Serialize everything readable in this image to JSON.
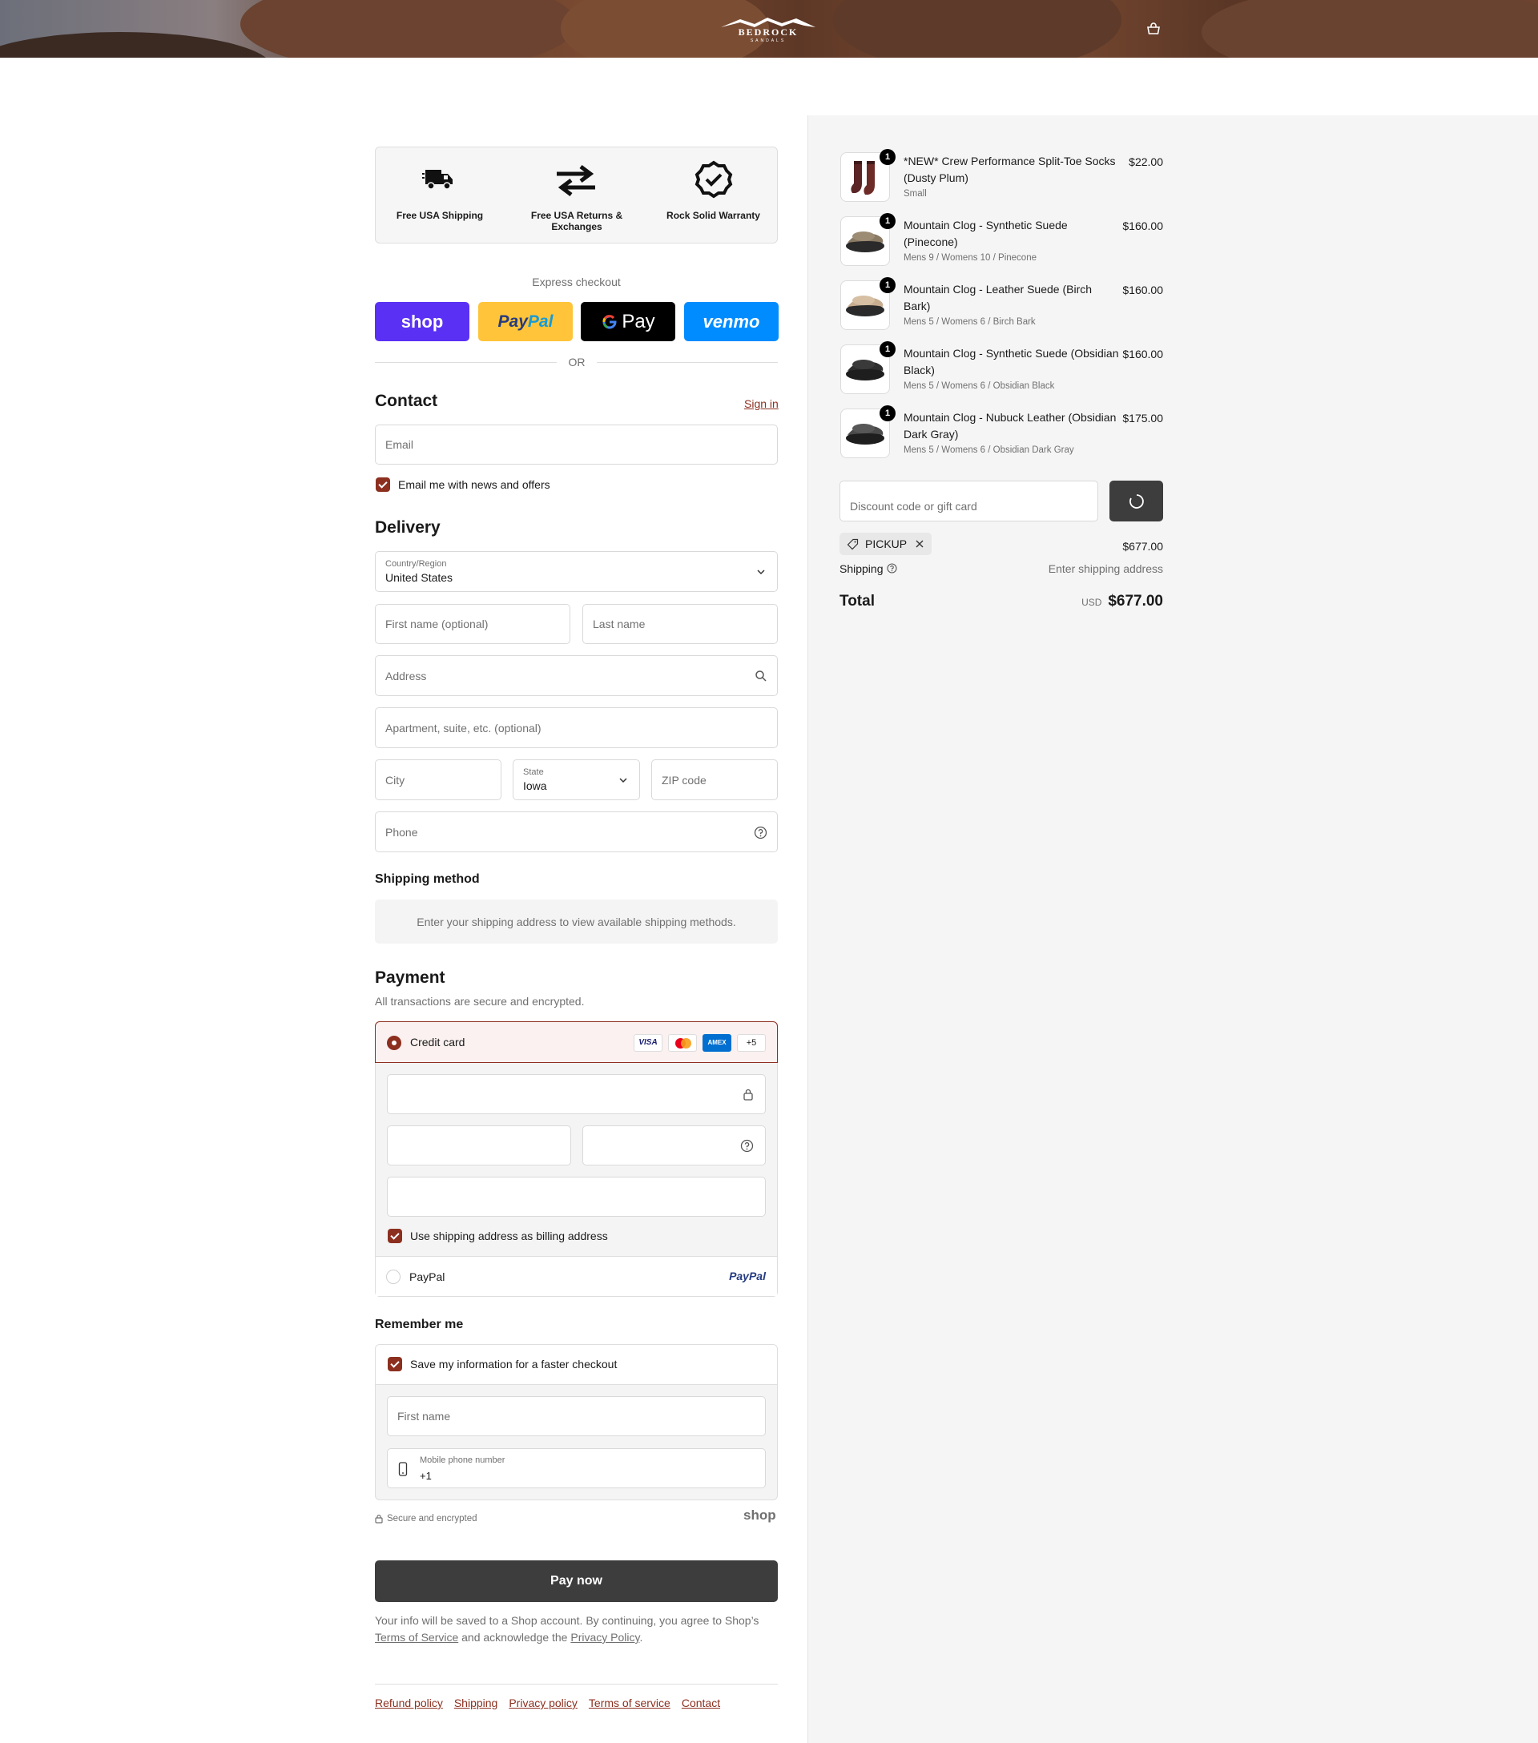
{
  "header": {
    "brand": "BEDROCK",
    "brand_sub": "SANDALS"
  },
  "perks": [
    {
      "icon": "truck-icon",
      "label": "Free USA Shipping"
    },
    {
      "icon": "exchange-arrows-icon",
      "label": "Free USA Returns & Exchanges"
    },
    {
      "icon": "badge-check-icon",
      "label": "Rock Solid Warranty"
    }
  ],
  "express": {
    "title": "Express checkout",
    "shop": "shop",
    "paypal_a": "Pay",
    "paypal_b": "Pal",
    "gpay": "Pay",
    "venmo": "venmo",
    "or": "OR"
  },
  "contact": {
    "title": "Contact",
    "sign_in": "Sign in",
    "email_placeholder": "Email",
    "news_label": "Email me with news and offers"
  },
  "delivery": {
    "title": "Delivery",
    "country_label": "Country/Region",
    "country_value": "United States",
    "first_name": "First name (optional)",
    "last_name": "Last name",
    "address": "Address",
    "apartment": "Apartment, suite, etc. (optional)",
    "city": "City",
    "state_label": "State",
    "state_value": "Iowa",
    "zip": "ZIP code",
    "phone": "Phone"
  },
  "shipping_method": {
    "title": "Shipping method",
    "message": "Enter your shipping address to view available shipping methods."
  },
  "payment": {
    "title": "Payment",
    "subtitle": "All transactions are secure and encrypted.",
    "credit_card": "Credit card",
    "cards": [
      "VISA",
      "AMEX",
      "+5"
    ],
    "billing_label": "Use shipping address as billing address",
    "paypal_label": "PayPal",
    "paypal_logo": "PayPal"
  },
  "remember": {
    "title": "Remember me",
    "save_label": "Save my information for a faster checkout",
    "first_name": "First name",
    "mobile_label": "Mobile phone number",
    "mobile_value": "+1",
    "secure": "Secure and encrypted",
    "shop_logo": "shop"
  },
  "pay_now": "Pay now",
  "legal": {
    "text1": "Your info will be saved to a Shop account. By continuing, you agree to Shop’s",
    "terms": "Terms of Service",
    "text2": "and acknowledge the",
    "privacy": "Privacy Policy",
    "text3": "."
  },
  "footer_links": [
    "Refund policy",
    "Shipping",
    "Privacy policy",
    "Terms of service",
    "Contact"
  ],
  "cart": {
    "items": [
      {
        "qty": "1",
        "name": "*NEW* Crew Performance Split-Toe Socks (Dusty Plum)",
        "variant": "Small",
        "price": "$22.00"
      },
      {
        "qty": "1",
        "name": "Mountain Clog - Synthetic Suede (Pinecone)",
        "variant": "Mens 9 / Womens 10 / Pinecone",
        "price": "$160.00"
      },
      {
        "qty": "1",
        "name": "Mountain Clog - Leather Suede (Birch Bark)",
        "variant": "Mens 5 / Womens 6 / Birch Bark",
        "price": "$160.00"
      },
      {
        "qty": "1",
        "name": "Mountain Clog - Synthetic Suede (Obsidian Black)",
        "variant": "Mens 5 / Womens 6 / Obsidian Black",
        "price": "$160.00"
      },
      {
        "qty": "1",
        "name": "Mountain Clog - Nubuck Leather (Obsidian Dark Gray)",
        "variant": "Mens 5 / Womens 6 / Obsidian Dark Gray",
        "price": "$175.00"
      }
    ],
    "discount_placeholder": "Discount code or gift card",
    "discount_tag": "PICKUP",
    "subtotal": "$677.00",
    "shipping_label": "Shipping",
    "shipping_value": "Enter shipping address",
    "total_label": "Total",
    "currency": "USD",
    "total": "$677.00"
  },
  "colors": {
    "accent": "#8c2f1f",
    "shop": "#5a31f4",
    "paypal": "#ffc439",
    "venmo": "#008cff",
    "pay_button": "#3d3d3d"
  }
}
